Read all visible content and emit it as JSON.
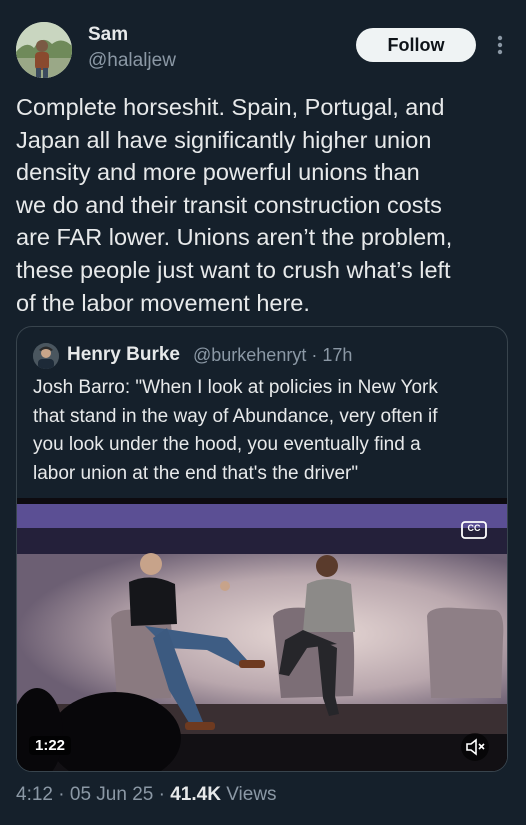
{
  "author": {
    "name": "Sam",
    "handle": "@halaljew",
    "follow_label": "Follow"
  },
  "icons": {
    "more": "more-vertical-icon",
    "cc": "closed-captions-icon",
    "mute": "muted-speaker-icon"
  },
  "tweet": {
    "text": "Complete horseshit. Spain, Portugal, and\nJapan all have significantly higher union\ndensity and more powerful unions than\nwe do and their transit construction costs\nare FAR lower. Unions aren’t the problem,\nthese people just want to crush what’s left\nof the labor movement here."
  },
  "quote": {
    "name": "Henry Burke",
    "handle": "@burkehenryt",
    "separator": "·",
    "time": "17h",
    "text": "Josh Barro: \"When I look at policies in New York\nthat stand in the way of Abundance, very often if\nyou look under the hood, you eventually find a\nlabor union at the end that's the driver\"",
    "video": {
      "duration": "1:22",
      "cc_label": "CC"
    }
  },
  "footer": {
    "time": "4:12",
    "sep1": "·",
    "date": "05 Jun 25",
    "sep2": "·",
    "views_count": "41.4K",
    "views_label": "Views"
  },
  "colors": {
    "background": "#15202b",
    "text_primary": "#e7e9ea",
    "text_secondary": "#8b98a5",
    "border": "#38444d",
    "follow_bg": "#eff3f4"
  }
}
